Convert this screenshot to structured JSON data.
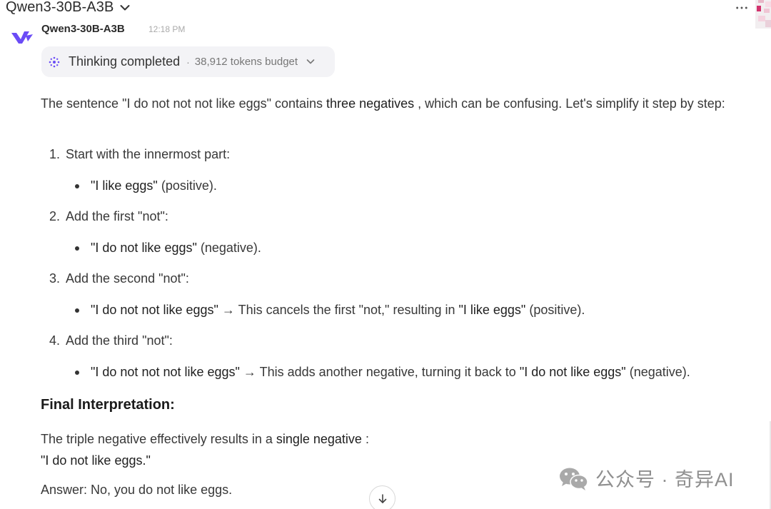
{
  "header": {
    "model_name": "Qwen3-30B-A3B"
  },
  "message": {
    "assistant_name": "Qwen3-30B-A3B",
    "timestamp": "12:18 PM",
    "thinking": {
      "label": "Thinking completed",
      "separator": "·",
      "budget": "38,912 tokens budget"
    },
    "intro": {
      "before": "The sentence \"I do not not not like eggs\" contains ",
      "highlight": "three negatives",
      "after": " , which can be confusing. Let's simplify it step by step:"
    },
    "steps": [
      {
        "num": "1.",
        "title": "Start with the innermost part:",
        "bullet_quote": "\"I like eggs\"",
        "bullet_rest": " (positive)."
      },
      {
        "num": "2.",
        "title": "Add the first \"not\":",
        "bullet_quote": "\"I do not like eggs\"",
        "bullet_rest": " (negative)."
      },
      {
        "num": "3.",
        "title": "Add the second \"not\":",
        "bullet_quote": "\"I do not not like eggs\"",
        "bullet_mid": " → This cancels the first \"not,\" resulting in ",
        "bullet_quote2": "\"I like eggs\"",
        "bullet_rest": " (positive)."
      },
      {
        "num": "4.",
        "title": "Add the third \"not\":",
        "bullet_quote": "\"I do not not not like eggs\"",
        "bullet_mid": " → This adds another negative, turning it back to ",
        "bullet_quote2": "\"I do not like eggs\"",
        "bullet_rest": " (negative)."
      }
    ],
    "final_heading": "Final Interpretation:",
    "conclusion_before": "The triple negative effectively results in a ",
    "conclusion_highlight": "single negative",
    "conclusion_after": " :",
    "conclusion_quote": "\"I do not like eggs.\"",
    "answer": "Answer: No, you do not like eggs."
  },
  "watermark": {
    "text": "公众号 · 奇异AI"
  },
  "icons": {
    "model_dropdown": "chevron-down-icon",
    "more": "more-icon",
    "logo": "qwen-logo-icon",
    "thinking": "sparkle-icon",
    "thinking_toggle": "chevron-down-icon",
    "scroll": "arrow-down-icon",
    "watermark": "wechat-icon"
  },
  "colors": {
    "pill_bg": "#f3f3f6",
    "logo": "#6b4cf6",
    "text": "#383838"
  }
}
